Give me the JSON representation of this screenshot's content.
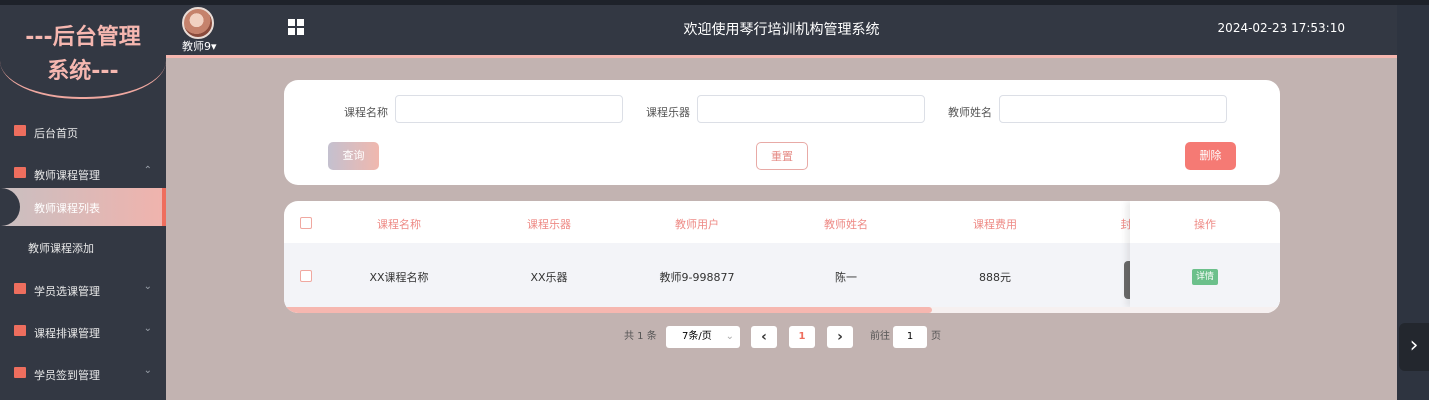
{
  "brand": {
    "line1": "---后台管理",
    "line2": "系统---"
  },
  "header": {
    "username": "教师9",
    "user_dropdown_glyph": "▾",
    "title": "欢迎使用琴行培训机构管理系统",
    "datetime": "2024-02-23 17:53:10"
  },
  "sidebar": {
    "items": [
      {
        "label": "后台首页"
      },
      {
        "label": "教师课程管理",
        "chevron": "⌃"
      },
      {
        "label": "学员选课管理",
        "chevron": "⌄"
      },
      {
        "label": "课程排课管理",
        "chevron": "⌄"
      },
      {
        "label": "学员签到管理",
        "chevron": "⌄"
      }
    ],
    "subitems": [
      {
        "label": "教师课程列表"
      },
      {
        "label": "教师课程添加"
      }
    ]
  },
  "search": {
    "fields": [
      {
        "label": "课程名称",
        "value": ""
      },
      {
        "label": "课程乐器",
        "value": ""
      },
      {
        "label": "教师姓名",
        "value": ""
      }
    ],
    "query_label": "查询",
    "reset_label": "重置",
    "delete_label": "删除"
  },
  "table": {
    "columns": [
      "课程名称",
      "课程乐器",
      "教师用户",
      "教师姓名",
      "课程费用",
      "封",
      "操作"
    ],
    "rows": [
      {
        "name": "XX课程名称",
        "instrument": "XX乐器",
        "teacher_user": "教师9-998877",
        "teacher_name": "陈一",
        "fee": "888元",
        "action": "详情"
      }
    ]
  },
  "pagination": {
    "total": "共 1 条",
    "page_size": "7条/页",
    "prev_glyph": "‹",
    "current_page": "1",
    "next_glyph": "›",
    "goto_prefix": "前往",
    "goto_value": "1",
    "goto_suffix": "页"
  },
  "nav": {
    "next_glyph": "›"
  },
  "colors": {
    "accent": "#f6b7b0",
    "danger": "#f57a74",
    "success": "#6cc08b",
    "sidebar": "#333843",
    "main_bg": "#c2b3b1"
  }
}
